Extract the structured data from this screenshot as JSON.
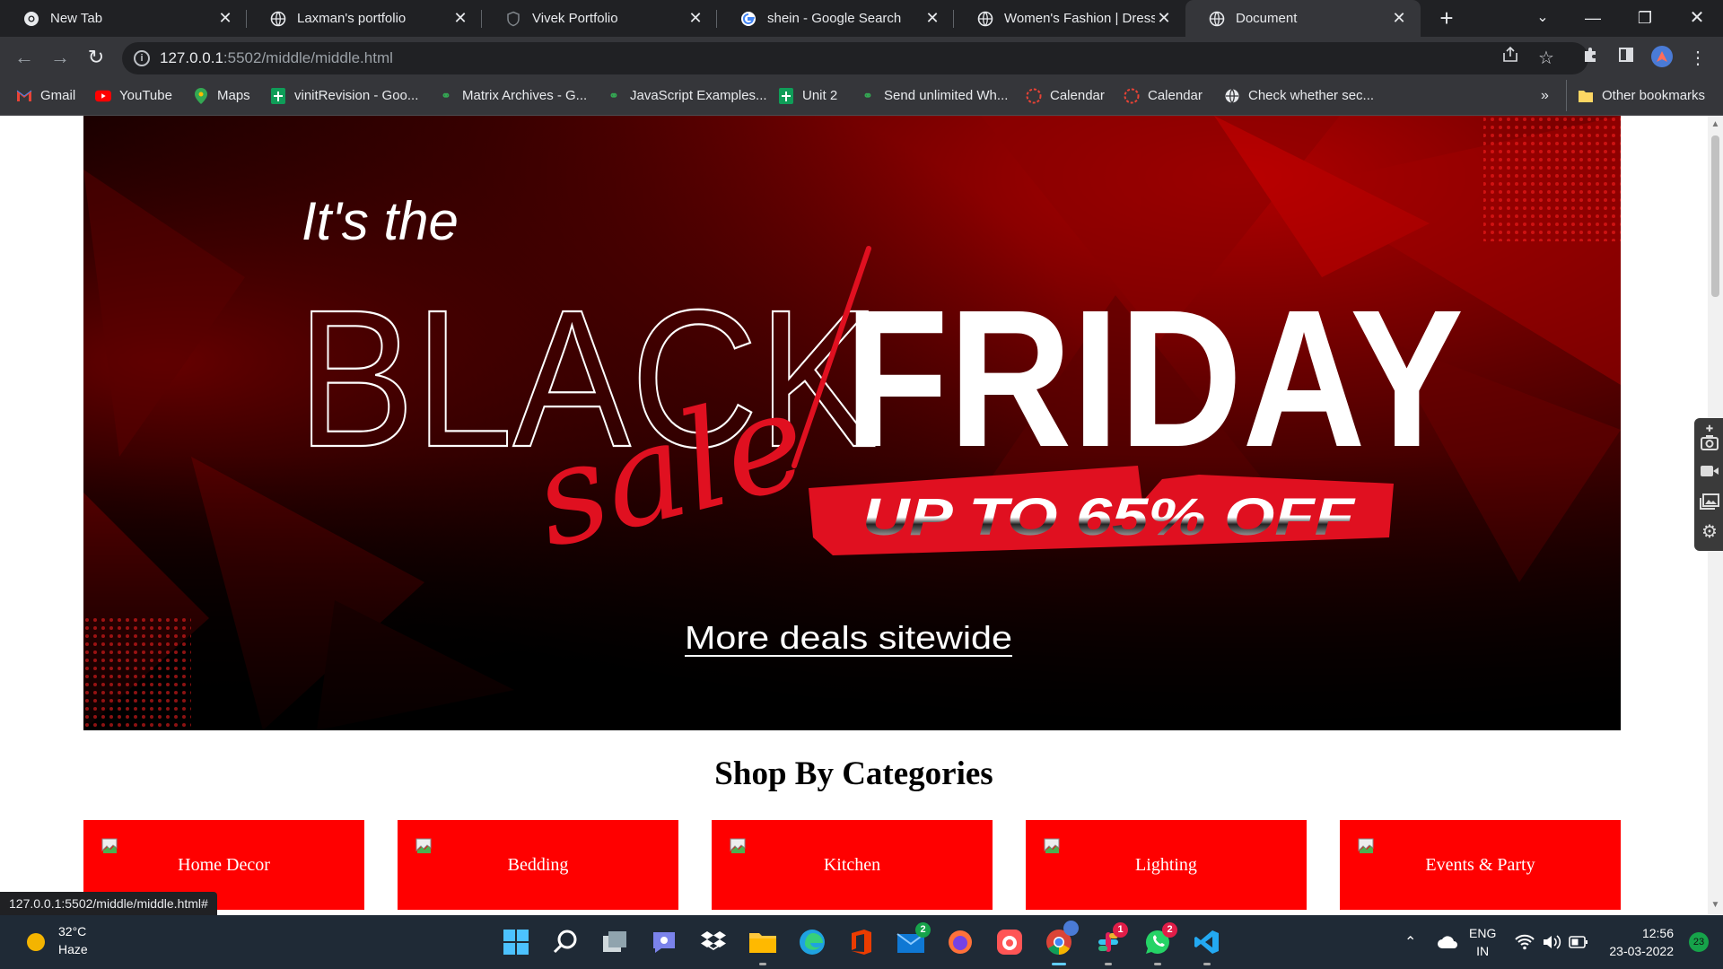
{
  "browser": {
    "tabs": [
      {
        "title": "New Tab",
        "icon": "chrome-icon"
      },
      {
        "title": "Laxman's portfolio",
        "icon": "globe-icon"
      },
      {
        "title": "Vivek Portfolio",
        "icon": "shield-icon"
      },
      {
        "title": "shein - Google Search",
        "icon": "google-icon"
      },
      {
        "title": "Women's Fashion | Dresses, ",
        "icon": "globe-icon"
      },
      {
        "title": "Document",
        "icon": "globe-icon",
        "active": true
      }
    ],
    "url_host": "127.0.0.1",
    "url_rest": ":5502/middle/middle.html",
    "bookmarks": [
      {
        "label": "Gmail",
        "icon": "gmail-icon"
      },
      {
        "label": "YouTube",
        "icon": "youtube-icon"
      },
      {
        "label": "Maps",
        "icon": "maps-icon"
      },
      {
        "label": "vinitRevision - Goo...",
        "icon": "sheets-icon"
      },
      {
        "label": "Matrix Archives - G...",
        "icon": "link-icon"
      },
      {
        "label": "JavaScript Examples...",
        "icon": "link-icon"
      },
      {
        "label": "Unit 2",
        "icon": "sheets-icon"
      },
      {
        "label": "Send unlimited Wh...",
        "icon": "link-icon"
      },
      {
        "label": "Calendar",
        "icon": "calendar-icon"
      },
      {
        "label": "Calendar",
        "icon": "calendar-icon"
      },
      {
        "label": "Check whether sec...",
        "icon": "globe-icon"
      }
    ],
    "overflow_label": "»",
    "other_bookmarks": "Other bookmarks",
    "status_url": "127.0.0.1:5502/middle/middle.html#"
  },
  "banner": {
    "intro": "It's the",
    "word_black": "BLACK",
    "word_friday": "FRIDAY",
    "script_word": "sale",
    "offer": "UP TO 65% OFF",
    "cta": "More deals sitewide"
  },
  "page": {
    "section_title": "Shop By Categories",
    "categories": [
      "Home Decor",
      "Bedding",
      "Kitchen",
      "Lighting",
      "Events & Party"
    ]
  },
  "taskbar": {
    "temperature": "32°C",
    "weather": "Haze",
    "language": "ENG",
    "region": "IN",
    "time": "12:56",
    "date": "23-03-2022",
    "notification_count": "23",
    "badges": {
      "mail": "2",
      "slack": "1",
      "whatsapp": "2"
    }
  },
  "colors": {
    "accent_red": "#ff0000",
    "chrome_dark": "#202124",
    "chrome_toolbar": "#35363a"
  }
}
